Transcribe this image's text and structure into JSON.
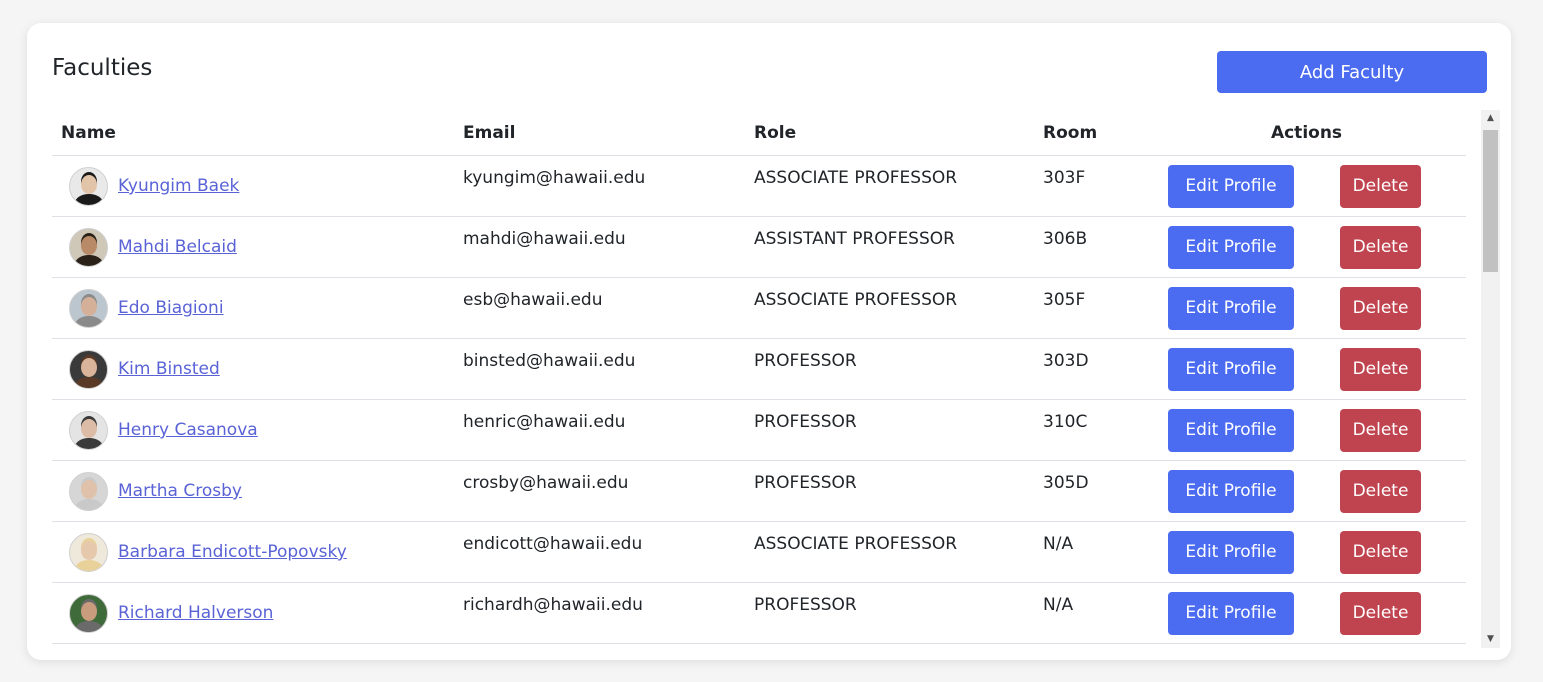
{
  "page": {
    "title": "Faculties",
    "add_button": "Add Faculty"
  },
  "table": {
    "columns": [
      "Name",
      "Email",
      "Role",
      "Room",
      "Actions"
    ],
    "edit_label": "Edit Profile",
    "delete_label": "Delete",
    "rows": [
      {
        "name": "Kyungim Baek",
        "email": "kyungim@hawaii.edu",
        "role": "ASSOCIATE PROFESSOR",
        "room": "303F",
        "avatar_skin": "#e2c4a8",
        "avatar_hair": "#1a1a1a",
        "avatar_bg": "#e9e9e9"
      },
      {
        "name": "Mahdi Belcaid",
        "email": "mahdi@hawaii.edu",
        "role": "ASSISTANT PROFESSOR",
        "room": "306B",
        "avatar_skin": "#b88a68",
        "avatar_hair": "#2a2118",
        "avatar_bg": "#cfc8b8"
      },
      {
        "name": "Edo Biagioni",
        "email": "esb@hawaii.edu",
        "role": "ASSOCIATE PROFESSOR",
        "room": "305F",
        "avatar_skin": "#d4b099",
        "avatar_hair": "#8a8a8a",
        "avatar_bg": "#bcc6cf"
      },
      {
        "name": "Kim Binsted",
        "email": "binsted@hawaii.edu",
        "role": "PROFESSOR",
        "room": "303D",
        "avatar_skin": "#d9b49a",
        "avatar_hair": "#5a3a26",
        "avatar_bg": "#3a3a3a"
      },
      {
        "name": "Henry Casanova",
        "email": "henric@hawaii.edu",
        "role": "PROFESSOR",
        "room": "310C",
        "avatar_skin": "#dcbca6",
        "avatar_hair": "#3a3a3a",
        "avatar_bg": "#e4e4e4"
      },
      {
        "name": "Martha Crosby",
        "email": "crosby@hawaii.edu",
        "role": "PROFESSOR",
        "room": "305D",
        "avatar_skin": "#e0c2aa",
        "avatar_hair": "#c9c9c9",
        "avatar_bg": "#d6d6d6"
      },
      {
        "name": "Barbara Endicott-Popovsky",
        "email": "endicott@hawaii.edu",
        "role": "ASSOCIATE PROFESSOR",
        "room": "N/A",
        "avatar_skin": "#e6c8ac",
        "avatar_hair": "#e8d29a",
        "avatar_bg": "#efe9dc"
      },
      {
        "name": "Richard Halverson",
        "email": "richardh@hawaii.edu",
        "role": "PROFESSOR",
        "room": "N/A",
        "avatar_skin": "#c89c7c",
        "avatar_hair": "#6a6a6a",
        "avatar_bg": "#3f6a3a"
      }
    ]
  },
  "colors": {
    "primary": "#4b6cf0",
    "danger": "#c0444f",
    "link": "#5a63d6"
  },
  "icons": {
    "scroll_up": "scroll-up-arrow-icon",
    "scroll_down": "scroll-down-arrow-icon"
  }
}
